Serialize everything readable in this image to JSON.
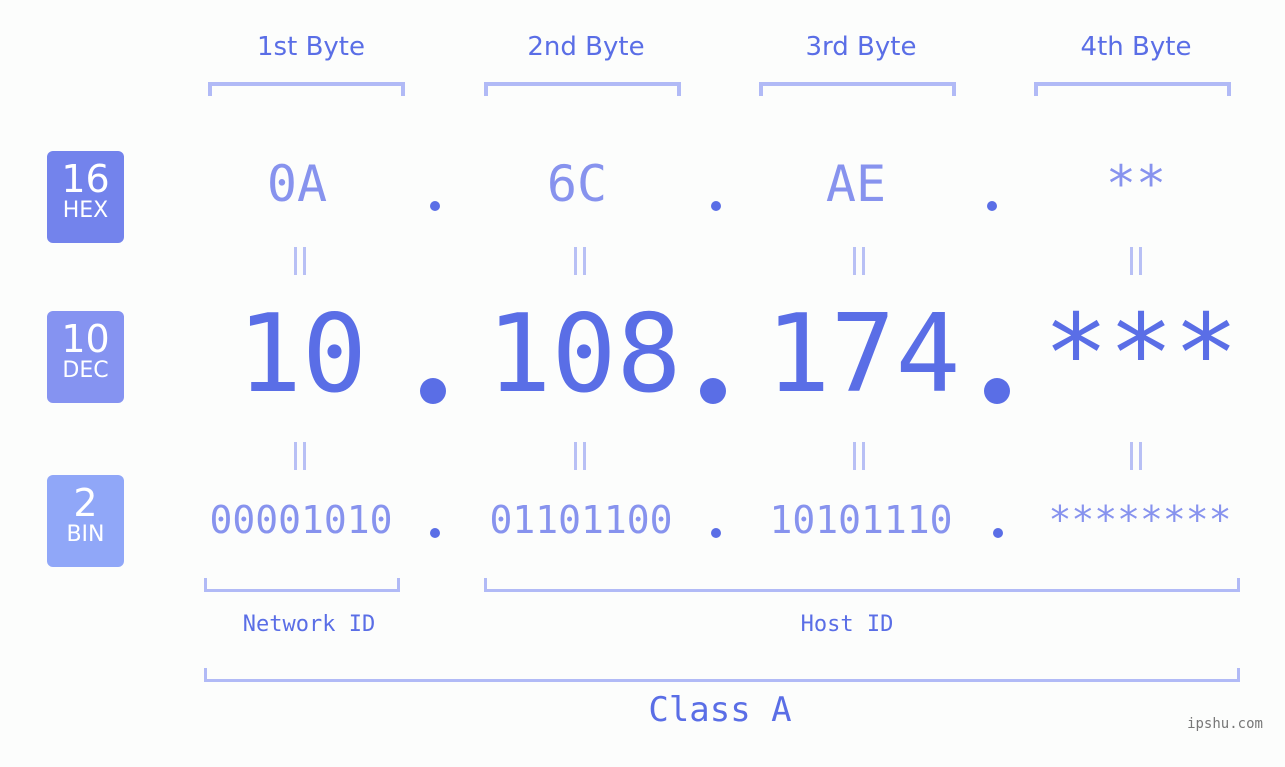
{
  "byte_headers": [
    "1st Byte",
    "2nd Byte",
    "3rd Byte",
    "4th Byte"
  ],
  "badges": {
    "hex": {
      "number": "16",
      "label": "HEX",
      "color": "#7383ec"
    },
    "dec": {
      "number": "10",
      "label": "DEC",
      "color": "#8593f1"
    },
    "bin": {
      "number": "2",
      "label": "BIN",
      "color": "#90a7f8"
    }
  },
  "hex_values": [
    "0A",
    "6C",
    "AE",
    "**"
  ],
  "dec_values": [
    "10",
    "108",
    "174",
    "***"
  ],
  "bin_values": [
    "00001010",
    "01101100",
    "10101110",
    "********"
  ],
  "separator": ".",
  "network_id_label": "Network ID",
  "host_id_label": "Host ID",
  "class_label": "Class A",
  "watermark": "ipshu.com",
  "colors": {
    "primary": "#5a6ee6",
    "secondary": "#8793ee",
    "bracket": "#b1baf6"
  }
}
